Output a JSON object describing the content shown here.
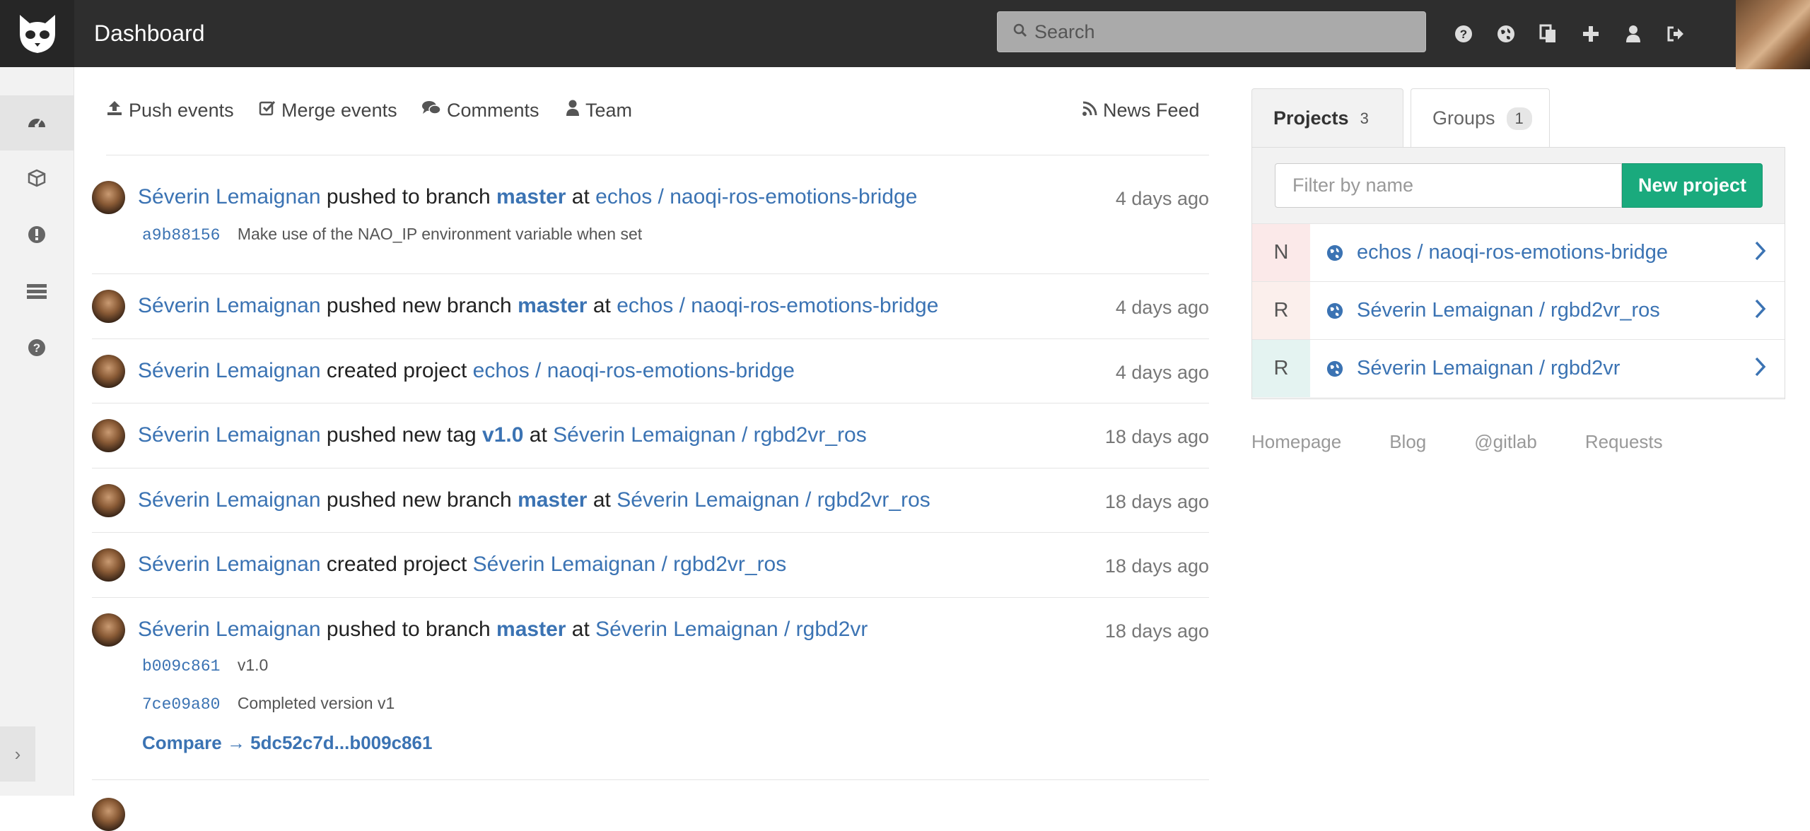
{
  "header": {
    "title": "Dashboard",
    "search_placeholder": "Search",
    "icons": [
      "help-icon",
      "globe-icon",
      "copy-icon",
      "plus-icon",
      "user-icon",
      "sign-out-icon"
    ]
  },
  "sidebar": {
    "items": [
      "dashboard-icon",
      "projects-icon",
      "issues-icon",
      "list-icon",
      "help-icon"
    ],
    "collapse_label": "›"
  },
  "event_tabs": {
    "push": "Push events",
    "merge": "Merge events",
    "comments": "Comments",
    "team": "Team",
    "news_feed": "News Feed"
  },
  "events": [
    {
      "author": "Séverin Lemaignan",
      "action": "pushed to branch",
      "ref": "master",
      "at": "at",
      "project": "echos / naoqi-ros-emotions-bridge",
      "time": "4 days ago",
      "commits": [
        {
          "sha": "a9b88156",
          "message": "Make use of the NAO_IP environment variable when set"
        }
      ]
    },
    {
      "author": "Séverin Lemaignan",
      "action": "pushed new branch",
      "ref": "master",
      "at": "at",
      "project": "echos / naoqi-ros-emotions-bridge",
      "time": "4 days ago"
    },
    {
      "author": "Séverin Lemaignan",
      "action": "created project",
      "project": "echos / naoqi-ros-emotions-bridge",
      "time": "4 days ago"
    },
    {
      "author": "Séverin Lemaignan",
      "action": "pushed new tag",
      "ref": "v1.0",
      "at": "at",
      "project": "Séverin Lemaignan / rgbd2vr_ros",
      "time": "18 days ago"
    },
    {
      "author": "Séverin Lemaignan",
      "action": "pushed new branch",
      "ref": "master",
      "at": "at",
      "project": "Séverin Lemaignan / rgbd2vr_ros",
      "time": "18 days ago"
    },
    {
      "author": "Séverin Lemaignan",
      "action": "created project",
      "project": "Séverin Lemaignan / rgbd2vr_ros",
      "time": "18 days ago"
    },
    {
      "author": "Séverin Lemaignan",
      "action": "pushed to branch",
      "ref": "master",
      "at": "at",
      "project": "Séverin Lemaignan / rgbd2vr",
      "time": "18 days ago",
      "commits": [
        {
          "sha": "b009c861",
          "message": "v1.0"
        },
        {
          "sha": "7ce09a80",
          "message": "Completed version v1"
        }
      ],
      "compare": "Compare → 5dc52c7d...b009c861"
    }
  ],
  "right_panel": {
    "tabs": [
      {
        "label": "Projects",
        "count": "3"
      },
      {
        "label": "Groups",
        "count": "1"
      }
    ],
    "filter_placeholder": "Filter by name",
    "new_project": "New project",
    "projects": [
      {
        "letter": "N",
        "name": "echos / naoqi-ros-emotions-bridge",
        "color": "#fbe9e9"
      },
      {
        "letter": "R",
        "name": "Séverin Lemaignan / rgbd2vr_ros",
        "color": "#fbefec"
      },
      {
        "letter": "R",
        "name": "Séverin Lemaignan / rgbd2vr",
        "color": "#e4f3f1"
      }
    ],
    "footer_links": [
      "Homepage",
      "Blog",
      "@gitlab",
      "Requests"
    ]
  },
  "colors": {
    "accent": "#1aaa7d",
    "link": "#3b73b3",
    "header": "#2e2e2e"
  }
}
